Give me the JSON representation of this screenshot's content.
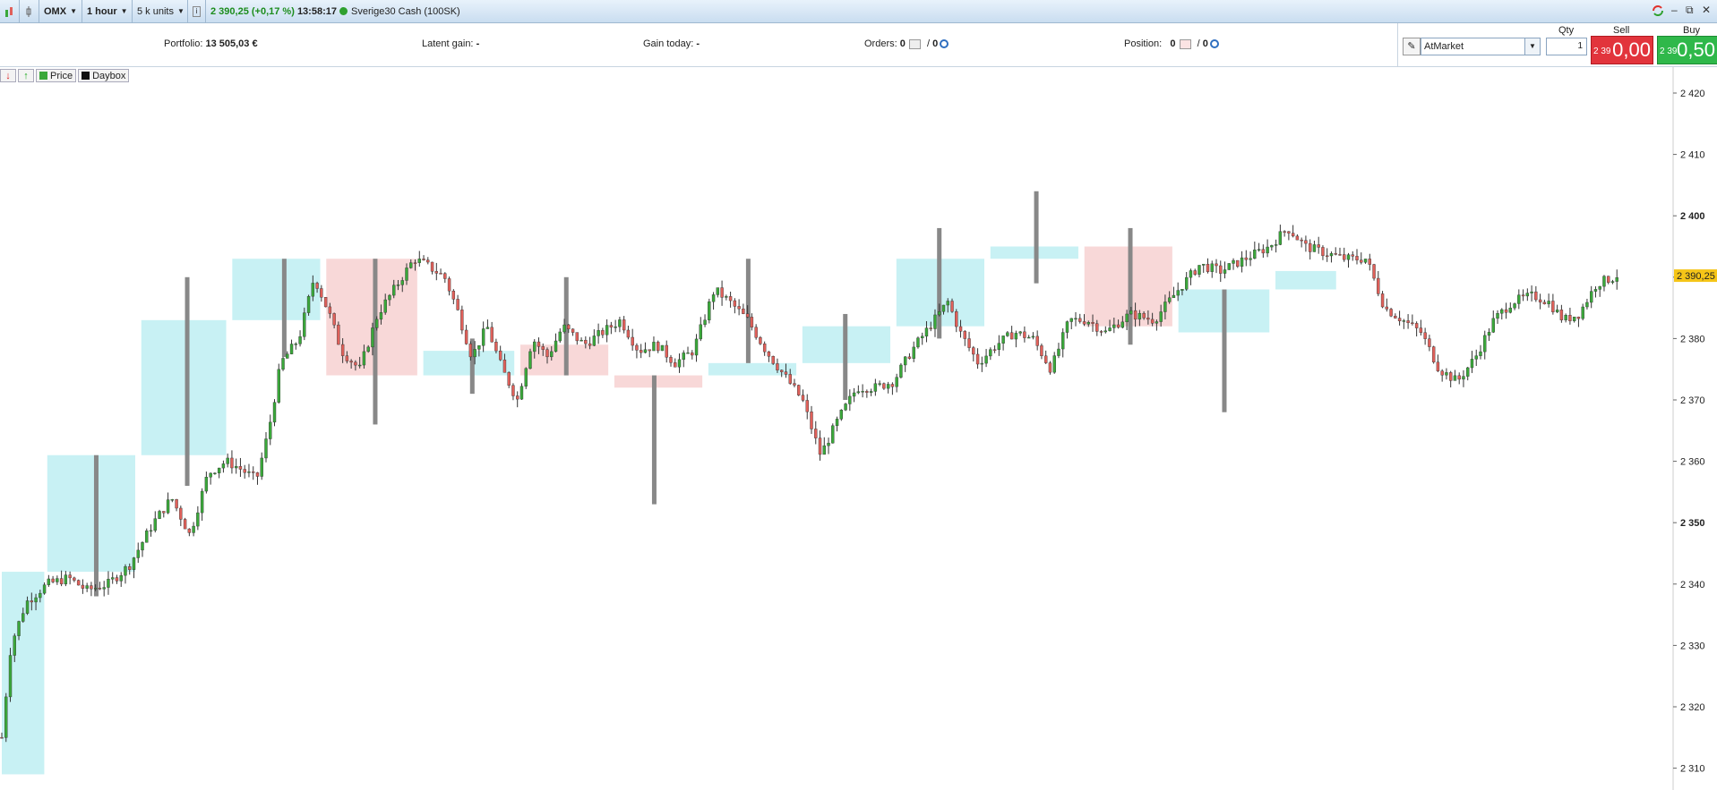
{
  "toolbar": {
    "symbol": "OMX",
    "timeframe": "1 hour",
    "size": "5 k units",
    "info_icon": "info-icon",
    "price_change": "2 390,25 (+0,17 %)",
    "time": "13:58:17",
    "instrument": "Sverige30 Cash (100SK)",
    "window_controls": [
      "–",
      "⧉",
      "✕"
    ]
  },
  "infobar": {
    "portfolio_label": "Portfolio:",
    "portfolio_value": "13 505,03 €",
    "latent_label": "Latent gain:",
    "latent_value": "-",
    "gain_today_label": "Gain today:",
    "gain_today_value": "-",
    "orders_label": "Orders:",
    "orders_a": "0",
    "orders_sep": "/",
    "orders_b": "0",
    "position_label": "Position:",
    "position_a": "0",
    "position_sep": "/",
    "position_b": "0"
  },
  "trade": {
    "qty_label": "Qty",
    "sell_label": "Sell",
    "buy_label": "Buy",
    "order_type": "AtMarket",
    "qty_value": "1",
    "sell_small": "2 39",
    "sell_big": "0,00",
    "buy_small": "2 39",
    "buy_big": "0,50"
  },
  "legend": {
    "price": "Price",
    "daybox": "Daybox"
  },
  "colors": {
    "bull": "#3aa83a",
    "bear": "#e0605a",
    "box_up": "#c8f1f4",
    "box_down": "#f8d8d8",
    "current_price_bg": "#f5c518"
  },
  "chart_data": {
    "type": "candlestick",
    "y_ticks": [
      "2 420",
      "2 410",
      "2 400",
      "2 390",
      "2 380",
      "2 370",
      "2 360",
      "2 350",
      "2 340",
      "2 330",
      "2 320",
      "2 310"
    ],
    "y_bold": [
      "2 400",
      "2 350"
    ],
    "ylim": [
      2308,
      2426
    ],
    "current_price": 2390.25,
    "current_price_label": "2 390,25",
    "candles_count": 380,
    "close_path": [
      [
        0,
        2315
      ],
      [
        3,
        2330
      ],
      [
        8,
        2337
      ],
      [
        15,
        2340
      ],
      [
        22,
        2341
      ],
      [
        28,
        2339
      ],
      [
        35,
        2340
      ],
      [
        42,
        2343
      ],
      [
        50,
        2350
      ],
      [
        56,
        2354
      ],
      [
        62,
        2348
      ],
      [
        68,
        2358
      ],
      [
        74,
        2360
      ],
      [
        78,
        2359
      ],
      [
        84,
        2357
      ],
      [
        88,
        2365
      ],
      [
        92,
        2376
      ],
      [
        98,
        2380
      ],
      [
        103,
        2390
      ],
      [
        108,
        2384
      ],
      [
        112,
        2378
      ],
      [
        118,
        2375
      ],
      [
        124,
        2384
      ],
      [
        128,
        2387
      ],
      [
        132,
        2390
      ],
      [
        136,
        2393
      ],
      [
        140,
        2392
      ],
      [
        146,
        2390
      ],
      [
        150,
        2385
      ],
      [
        155,
        2377
      ],
      [
        160,
        2382
      ],
      [
        165,
        2375
      ],
      [
        170,
        2370
      ],
      [
        175,
        2380
      ],
      [
        180,
        2377
      ],
      [
        185,
        2382
      ],
      [
        192,
        2379
      ],
      [
        198,
        2381
      ],
      [
        204,
        2383
      ],
      [
        210,
        2378
      ],
      [
        216,
        2379
      ],
      [
        222,
        2376
      ],
      [
        228,
        2378
      ],
      [
        235,
        2388
      ],
      [
        240,
        2386
      ],
      [
        246,
        2383
      ],
      [
        252,
        2378
      ],
      [
        258,
        2374
      ],
      [
        264,
        2370
      ],
      [
        270,
        2361
      ],
      [
        276,
        2367
      ],
      [
        282,
        2372
      ],
      [
        288,
        2372
      ],
      [
        294,
        2373
      ],
      [
        300,
        2378
      ],
      [
        306,
        2382
      ],
      [
        312,
        2386
      ],
      [
        316,
        2381
      ],
      [
        322,
        2376
      ],
      [
        328,
        2379
      ],
      [
        334,
        2381
      ],
      [
        340,
        2380
      ],
      [
        346,
        2375
      ],
      [
        352,
        2383
      ],
      [
        358,
        2383
      ],
      [
        364,
        2381
      ],
      [
        372,
        2384
      ],
      [
        380,
        2383
      ],
      [
        388,
        2388
      ],
      [
        395,
        2392
      ],
      [
        402,
        2391
      ],
      [
        410,
        2393
      ],
      [
        418,
        2395
      ],
      [
        424,
        2398
      ],
      [
        430,
        2395
      ],
      [
        436,
        2394
      ],
      [
        443,
        2393
      ],
      [
        450,
        2393
      ],
      [
        456,
        2385
      ],
      [
        462,
        2383
      ],
      [
        468,
        2381
      ],
      [
        474,
        2375
      ],
      [
        480,
        2373
      ],
      [
        486,
        2377
      ],
      [
        492,
        2383
      ],
      [
        498,
        2386
      ],
      [
        505,
        2387
      ],
      [
        510,
        2386
      ],
      [
        515,
        2383
      ],
      [
        520,
        2384
      ],
      [
        526,
        2389
      ],
      [
        532,
        2390
      ],
      [
        534,
        2391
      ]
    ],
    "dayboxes": [
      {
        "x0": 0,
        "x1": 14,
        "lo": 2309,
        "hi": 2342,
        "up": true
      },
      {
        "x0": 15,
        "x1": 44,
        "lo": 2342,
        "hi": 2361,
        "up": true
      },
      {
        "x0": 46,
        "x1": 74,
        "lo": 2361,
        "hi": 2383,
        "up": true
      },
      {
        "x0": 76,
        "x1": 105,
        "lo": 2383,
        "hi": 2393,
        "up": true
      },
      {
        "x0": 107,
        "x1": 137,
        "lo": 2374,
        "hi": 2393,
        "up": false
      },
      {
        "x0": 139,
        "x1": 169,
        "lo": 2374,
        "hi": 2378,
        "up": true
      },
      {
        "x0": 171,
        "x1": 200,
        "lo": 2374,
        "hi": 2379,
        "up": false
      },
      {
        "x0": 202,
        "x1": 231,
        "lo": 2372,
        "hi": 2374,
        "up": false
      },
      {
        "x0": 233,
        "x1": 262,
        "lo": 2374,
        "hi": 2376,
        "up": true
      },
      {
        "x0": 264,
        "x1": 293,
        "lo": 2376,
        "hi": 2382,
        "up": true
      },
      {
        "x0": 295,
        "x1": 324,
        "lo": 2382,
        "hi": 2393,
        "up": true
      },
      {
        "x0": 326,
        "x1": 355,
        "lo": 2393,
        "hi": 2395,
        "up": true
      },
      {
        "x0": 357,
        "x1": 386,
        "lo": 2382,
        "hi": 2395,
        "up": false
      },
      {
        "x0": 388,
        "x1": 418,
        "lo": 2381,
        "hi": 2388,
        "up": true
      },
      {
        "x0": 420,
        "x1": 440,
        "lo": 2388,
        "hi": 2391,
        "up": true
      }
    ],
    "volume_spikes": [
      {
        "x": 31,
        "lo": 2338,
        "hi": 2361
      },
      {
        "x": 61,
        "lo": 2356,
        "hi": 2390
      },
      {
        "x": 93,
        "lo": 2377,
        "hi": 2393
      },
      {
        "x": 123,
        "lo": 2366,
        "hi": 2393
      },
      {
        "x": 155,
        "lo": 2371,
        "hi": 2380
      },
      {
        "x": 186,
        "lo": 2374,
        "hi": 2390
      },
      {
        "x": 215,
        "lo": 2353,
        "hi": 2374
      },
      {
        "x": 246,
        "lo": 2376,
        "hi": 2393
      },
      {
        "x": 278,
        "lo": 2370,
        "hi": 2384
      },
      {
        "x": 309,
        "lo": 2380,
        "hi": 2398
      },
      {
        "x": 341,
        "lo": 2389,
        "hi": 2404
      },
      {
        "x": 372,
        "lo": 2379,
        "hi": 2398
      },
      {
        "x": 403,
        "lo": 2368,
        "hi": 2388
      }
    ]
  }
}
